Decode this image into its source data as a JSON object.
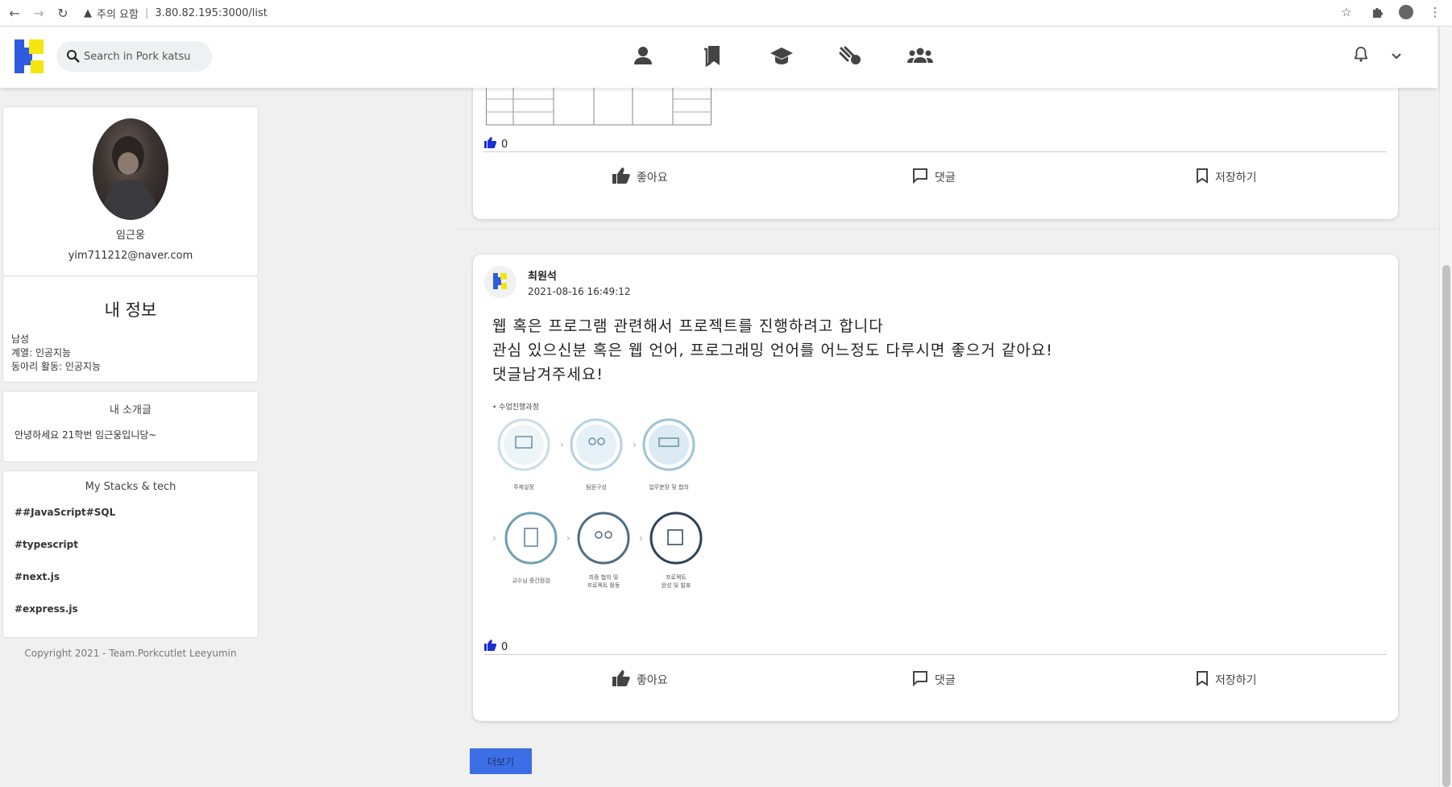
{
  "browser": {
    "warning": "주의 요함",
    "url": "3.80.82.195:3000/list"
  },
  "header": {
    "search_placeholder": "Search in Pork katsu"
  },
  "profile": {
    "name": "임근웅",
    "email": "yim711212@naver.com"
  },
  "myinfo": {
    "title": "내 정보",
    "gender": "남성",
    "field": "계열: 인공지능",
    "club": "동아리 활동: 인공지능"
  },
  "intro": {
    "title": "내 소개글",
    "text": "안녕하세요 21학번 임근웅입니당~"
  },
  "stacks": {
    "title": "My Stacks & tech",
    "tags": [
      "##JavaScript#SQL",
      "#typescript",
      "#next.js",
      "#express.js"
    ]
  },
  "copyright": "Copyright 2021 - Team.Porkcutlet Leeyumin",
  "posts": [
    {
      "likes": "0",
      "actions": {
        "like": "좋아요",
        "comment": "댓글",
        "save": "저장하기"
      }
    },
    {
      "author": "최원석",
      "date": "2021-08-16 16:49:12",
      "lines": [
        "웹 혹은 프로그램 관련해서 프로젝트를 진행하려고 합니다",
        "관심 있으신분 혹은 웹 언어, 프로그래밍 언어를 어느정도 다루시면 좋으거 같아요!",
        "댓글남겨주세요!"
      ],
      "diagram": {
        "heading": "• 수업진행과정",
        "steps": [
          "주제설정",
          "팀원구성",
          "업무분장 및 협의",
          "교수님 중간점검",
          "최종 협의 및",
          "프로젝트 활동",
          "프로젝트",
          "완성 및 발표"
        ]
      },
      "likes": "0",
      "actions": {
        "like": "좋아요",
        "comment": "댓글",
        "save": "저장하기"
      }
    }
  ],
  "more_label": "더보기",
  "colors": {
    "accent": "#3c6ee6",
    "like_blue": "#1a2fd6",
    "logo_blue": "#2f5be0",
    "logo_yellow": "#f5e50f"
  }
}
